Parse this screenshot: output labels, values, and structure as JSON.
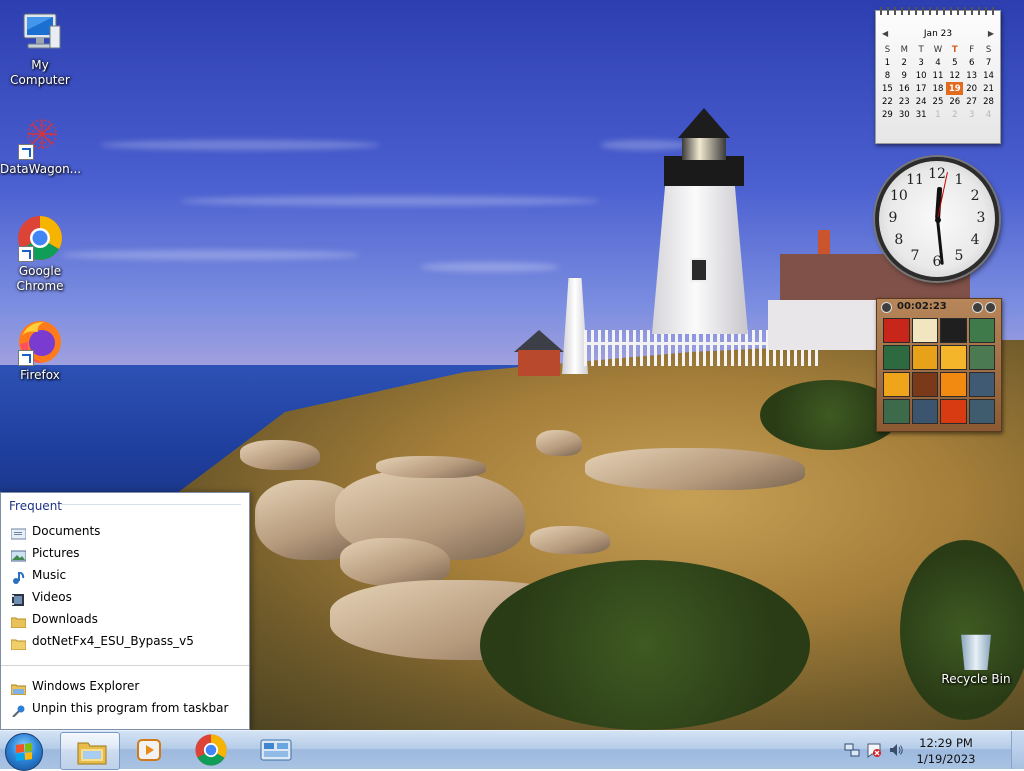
{
  "desktop": {
    "icons": [
      {
        "label": "My Computer",
        "icon": "computer-icon"
      },
      {
        "label": "DataWagon...",
        "icon": "datawagon-icon"
      },
      {
        "label": "Google Chrome",
        "icon": "chrome-icon"
      },
      {
        "label": "Firefox",
        "icon": "firefox-icon"
      }
    ],
    "recycle_bin": {
      "label": "Recycle Bin",
      "icon": "recycle-bin-icon"
    }
  },
  "jumplist": {
    "section_title": "Frequent",
    "items": [
      {
        "label": "Documents",
        "icon": "documents-icon"
      },
      {
        "label": "Pictures",
        "icon": "pictures-icon"
      },
      {
        "label": "Music",
        "icon": "music-icon"
      },
      {
        "label": "Videos",
        "icon": "videos-icon"
      },
      {
        "label": "Downloads",
        "icon": "downloads-folder-icon"
      },
      {
        "label": "dotNetFx4_ESU_Bypass_v5",
        "icon": "folder-icon"
      }
    ],
    "tasks": [
      {
        "label": "Windows Explorer",
        "icon": "windows-explorer-icon"
      },
      {
        "label": "Unpin this program from taskbar",
        "icon": "unpin-icon"
      }
    ]
  },
  "calendar_gadget": {
    "month": "Jan 23",
    "weekdays": [
      "S",
      "M",
      "T",
      "W",
      "T",
      "F",
      "S"
    ],
    "weeks": [
      [
        {
          "d": "",
          "o": true
        },
        {
          "d": "",
          "o": true
        },
        {
          "d": "",
          "o": true
        },
        {
          "d": "",
          "o": true
        },
        {
          "d": "",
          "o": true
        },
        {
          "d": "",
          "o": true
        },
        {
          "d": "",
          "o": true
        }
      ],
      [
        {
          "d": "1"
        },
        {
          "d": "2"
        },
        {
          "d": "3"
        },
        {
          "d": "4"
        },
        {
          "d": "5"
        },
        {
          "d": "6"
        },
        {
          "d": "7"
        }
      ],
      [
        {
          "d": "8"
        },
        {
          "d": "9"
        },
        {
          "d": "10"
        },
        {
          "d": "11"
        },
        {
          "d": "12"
        },
        {
          "d": "13"
        },
        {
          "d": "14"
        }
      ],
      [
        {
          "d": "15"
        },
        {
          "d": "16"
        },
        {
          "d": "17"
        },
        {
          "d": "18"
        },
        {
          "d": "19",
          "today": true
        },
        {
          "d": "20"
        },
        {
          "d": "21"
        }
      ],
      [
        {
          "d": "22"
        },
        {
          "d": "23"
        },
        {
          "d": "24"
        },
        {
          "d": "25"
        },
        {
          "d": "26"
        },
        {
          "d": "27"
        },
        {
          "d": "28"
        }
      ],
      [
        {
          "d": "29"
        },
        {
          "d": "30"
        },
        {
          "d": "31"
        },
        {
          "d": "1",
          "o": true
        },
        {
          "d": "2",
          "o": true
        },
        {
          "d": "3",
          "o": true
        },
        {
          "d": "4",
          "o": true
        }
      ]
    ],
    "today_weekday_index": 4,
    "accent": "#e36b1e"
  },
  "clock_gadget": {
    "numbers": [
      "12",
      "1",
      "2",
      "3",
      "4",
      "5",
      "6",
      "7",
      "8",
      "9",
      "10",
      "11"
    ],
    "time": "12:29"
  },
  "puzzle_gadget": {
    "timer": "00:02:23",
    "tiles": [
      "#c8261a",
      "#f2e6c0",
      "#1f1f1f",
      "#3f7a4a",
      "#2e6a3f",
      "#e8a219",
      "#f5b52a",
      "#4b7a52",
      "#f0a41a",
      "#7a3a1a",
      "#f28a12",
      "#3f5a72",
      "#3d6a4a",
      "#3b556e",
      "#d83a12",
      "#3e5c6e"
    ]
  },
  "taskbar": {
    "buttons": [
      {
        "name": "windows-explorer",
        "icon": "folder-icon",
        "active": true
      },
      {
        "name": "windows-media-player",
        "icon": "media-player-icon",
        "active": false
      },
      {
        "name": "google-chrome",
        "icon": "chrome-icon",
        "active": false
      },
      {
        "name": "control-panel",
        "icon": "control-panel-icon",
        "active": false
      }
    ],
    "tray": {
      "time": "12:29 PM",
      "date": "1/19/2023",
      "icons": [
        "network-icon",
        "action-center-icon",
        "volume-icon"
      ]
    }
  }
}
